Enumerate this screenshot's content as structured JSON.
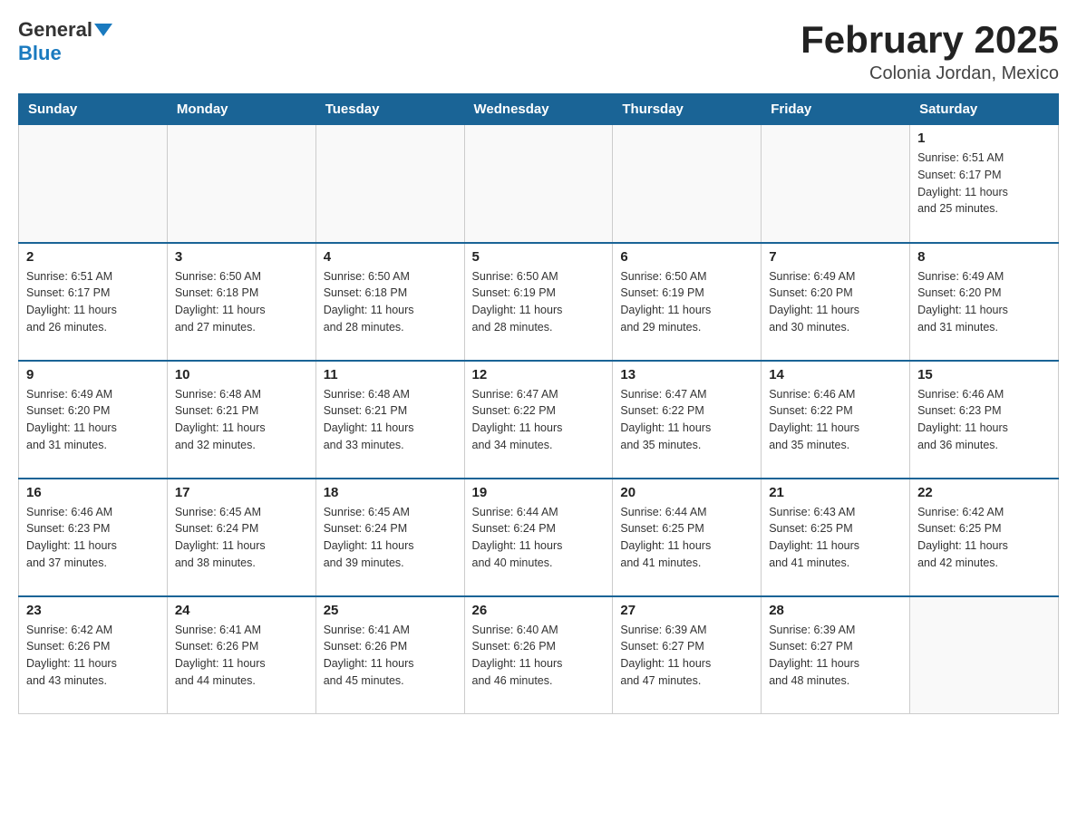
{
  "header": {
    "logo_general": "General",
    "logo_blue": "Blue",
    "month_title": "February 2025",
    "location": "Colonia Jordan, Mexico"
  },
  "days_of_week": [
    "Sunday",
    "Monday",
    "Tuesday",
    "Wednesday",
    "Thursday",
    "Friday",
    "Saturday"
  ],
  "weeks": [
    [
      {
        "day": "",
        "info": ""
      },
      {
        "day": "",
        "info": ""
      },
      {
        "day": "",
        "info": ""
      },
      {
        "day": "",
        "info": ""
      },
      {
        "day": "",
        "info": ""
      },
      {
        "day": "",
        "info": ""
      },
      {
        "day": "1",
        "info": "Sunrise: 6:51 AM\nSunset: 6:17 PM\nDaylight: 11 hours\nand 25 minutes."
      }
    ],
    [
      {
        "day": "2",
        "info": "Sunrise: 6:51 AM\nSunset: 6:17 PM\nDaylight: 11 hours\nand 26 minutes."
      },
      {
        "day": "3",
        "info": "Sunrise: 6:50 AM\nSunset: 6:18 PM\nDaylight: 11 hours\nand 27 minutes."
      },
      {
        "day": "4",
        "info": "Sunrise: 6:50 AM\nSunset: 6:18 PM\nDaylight: 11 hours\nand 28 minutes."
      },
      {
        "day": "5",
        "info": "Sunrise: 6:50 AM\nSunset: 6:19 PM\nDaylight: 11 hours\nand 28 minutes."
      },
      {
        "day": "6",
        "info": "Sunrise: 6:50 AM\nSunset: 6:19 PM\nDaylight: 11 hours\nand 29 minutes."
      },
      {
        "day": "7",
        "info": "Sunrise: 6:49 AM\nSunset: 6:20 PM\nDaylight: 11 hours\nand 30 minutes."
      },
      {
        "day": "8",
        "info": "Sunrise: 6:49 AM\nSunset: 6:20 PM\nDaylight: 11 hours\nand 31 minutes."
      }
    ],
    [
      {
        "day": "9",
        "info": "Sunrise: 6:49 AM\nSunset: 6:20 PM\nDaylight: 11 hours\nand 31 minutes."
      },
      {
        "day": "10",
        "info": "Sunrise: 6:48 AM\nSunset: 6:21 PM\nDaylight: 11 hours\nand 32 minutes."
      },
      {
        "day": "11",
        "info": "Sunrise: 6:48 AM\nSunset: 6:21 PM\nDaylight: 11 hours\nand 33 minutes."
      },
      {
        "day": "12",
        "info": "Sunrise: 6:47 AM\nSunset: 6:22 PM\nDaylight: 11 hours\nand 34 minutes."
      },
      {
        "day": "13",
        "info": "Sunrise: 6:47 AM\nSunset: 6:22 PM\nDaylight: 11 hours\nand 35 minutes."
      },
      {
        "day": "14",
        "info": "Sunrise: 6:46 AM\nSunset: 6:22 PM\nDaylight: 11 hours\nand 35 minutes."
      },
      {
        "day": "15",
        "info": "Sunrise: 6:46 AM\nSunset: 6:23 PM\nDaylight: 11 hours\nand 36 minutes."
      }
    ],
    [
      {
        "day": "16",
        "info": "Sunrise: 6:46 AM\nSunset: 6:23 PM\nDaylight: 11 hours\nand 37 minutes."
      },
      {
        "day": "17",
        "info": "Sunrise: 6:45 AM\nSunset: 6:24 PM\nDaylight: 11 hours\nand 38 minutes."
      },
      {
        "day": "18",
        "info": "Sunrise: 6:45 AM\nSunset: 6:24 PM\nDaylight: 11 hours\nand 39 minutes."
      },
      {
        "day": "19",
        "info": "Sunrise: 6:44 AM\nSunset: 6:24 PM\nDaylight: 11 hours\nand 40 minutes."
      },
      {
        "day": "20",
        "info": "Sunrise: 6:44 AM\nSunset: 6:25 PM\nDaylight: 11 hours\nand 41 minutes."
      },
      {
        "day": "21",
        "info": "Sunrise: 6:43 AM\nSunset: 6:25 PM\nDaylight: 11 hours\nand 41 minutes."
      },
      {
        "day": "22",
        "info": "Sunrise: 6:42 AM\nSunset: 6:25 PM\nDaylight: 11 hours\nand 42 minutes."
      }
    ],
    [
      {
        "day": "23",
        "info": "Sunrise: 6:42 AM\nSunset: 6:26 PM\nDaylight: 11 hours\nand 43 minutes."
      },
      {
        "day": "24",
        "info": "Sunrise: 6:41 AM\nSunset: 6:26 PM\nDaylight: 11 hours\nand 44 minutes."
      },
      {
        "day": "25",
        "info": "Sunrise: 6:41 AM\nSunset: 6:26 PM\nDaylight: 11 hours\nand 45 minutes."
      },
      {
        "day": "26",
        "info": "Sunrise: 6:40 AM\nSunset: 6:26 PM\nDaylight: 11 hours\nand 46 minutes."
      },
      {
        "day": "27",
        "info": "Sunrise: 6:39 AM\nSunset: 6:27 PM\nDaylight: 11 hours\nand 47 minutes."
      },
      {
        "day": "28",
        "info": "Sunrise: 6:39 AM\nSunset: 6:27 PM\nDaylight: 11 hours\nand 48 minutes."
      },
      {
        "day": "",
        "info": ""
      }
    ]
  ]
}
